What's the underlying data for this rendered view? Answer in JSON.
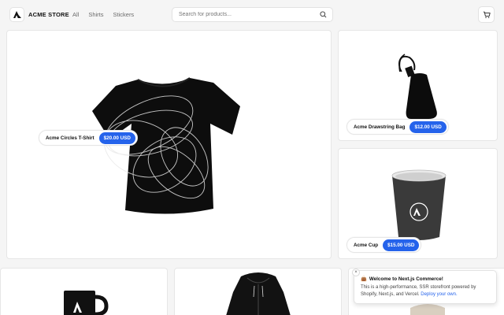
{
  "header": {
    "brand": "ACME STORE",
    "menu": [
      {
        "label": "All"
      },
      {
        "label": "Shirts"
      },
      {
        "label": "Stickers"
      }
    ],
    "search_placeholder": "Search for products..."
  },
  "featured": [
    {
      "name": "Acme Circles T-Shirt",
      "price": "$20.00 USD"
    },
    {
      "name": "Acme Drawstring Bag",
      "price": "$12.00 USD"
    },
    {
      "name": "Acme Cup",
      "price": "$15.00 USD"
    }
  ],
  "toast": {
    "emoji": "👜",
    "title": "Welcome to Next.js Commerce!",
    "body": "This is a high-performance, SSR storefront powered by Shopify, Next.js, and Vercel.",
    "link": "Deploy your own.",
    "close": "×"
  },
  "colors": {
    "accent": "#2563eb",
    "background": "#f5f5f5"
  },
  "icons": [
    "acme-logo-icon",
    "search-icon",
    "cart-icon",
    "close-icon"
  ]
}
